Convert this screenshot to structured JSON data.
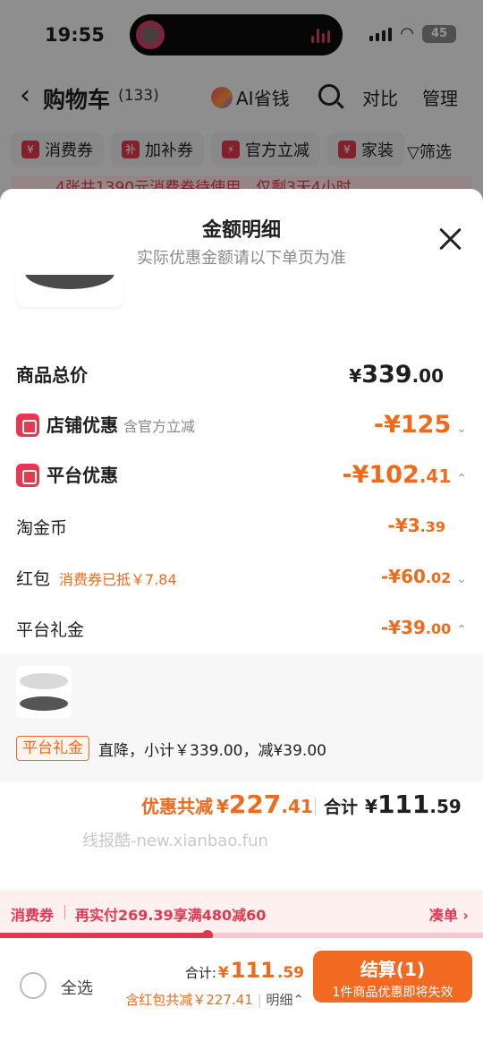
{
  "status_bar": {
    "time": "19:55",
    "battery": "45"
  },
  "nav": {
    "title": "购物车",
    "count": "(133)",
    "ai_label": "AI省钱",
    "compare": "对比",
    "manage": "管理"
  },
  "filters": [
    {
      "label": "消费券",
      "icon": "¥"
    },
    {
      "label": "加补券",
      "icon": "补"
    },
    {
      "label": "官方立减",
      "icon": "⚡"
    },
    {
      "label": "家装",
      "icon": "¥"
    }
  ],
  "filter_button": "筛选",
  "banner": "4张共1390元消费券待使用，仅剩3天4小时",
  "sheet": {
    "title": "金额明细",
    "subtitle": "实际优惠金额请以下单页为准",
    "total_goods": {
      "label": "商品总价",
      "yen": "¥",
      "int": "339",
      "dec": ".00"
    },
    "store_discount": {
      "label": "店铺优惠",
      "note": "含官方立减",
      "amount": "-¥125",
      "chevron": "⌄"
    },
    "platform_discount": {
      "label": "平台优惠",
      "int": "-¥102",
      "dec": ".41",
      "chevron": "⌃"
    },
    "taojinbi": {
      "label": "淘金币",
      "int": "-¥3",
      "dec": ".39"
    },
    "hongbao": {
      "label": "红包",
      "note": "消费券已抵￥7.84",
      "int": "-¥60",
      "dec": ".02",
      "chevron": "⌄"
    },
    "gift": {
      "label": "平台礼金",
      "int": "-¥39",
      "dec": ".00",
      "chevron": "⌃"
    },
    "gift_detail": {
      "tag": "平台礼金",
      "desc": "直降，小计￥339.00，减¥39.00"
    },
    "summary": {
      "saved_label": "优惠共减",
      "saved_yen": "¥",
      "saved_int": "227",
      "saved_dec": ".41",
      "total_label": "合计",
      "total_yen": "¥",
      "total_int": "111",
      "total_dec": ".59"
    },
    "watermark": "线报酷-new.xianbao.fun"
  },
  "coupon_bar": {
    "label": "消费券",
    "text": "再实付269.39享满480减60",
    "action": "凑单 ›",
    "progress": 0.43
  },
  "footer": {
    "select_all": "全选",
    "total_prefix": "合计:",
    "total_yen": "¥",
    "total_int": "111",
    "total_dec": ".59",
    "sub": "含红包共减￥227.41",
    "detail": "明细⌃",
    "checkout": "结算(1)",
    "checkout_sub": "1件商品优惠即将失效"
  },
  "colors": {
    "accent": "#ef6a1a",
    "red": "#e0384d",
    "checkout": "#f26a21"
  }
}
